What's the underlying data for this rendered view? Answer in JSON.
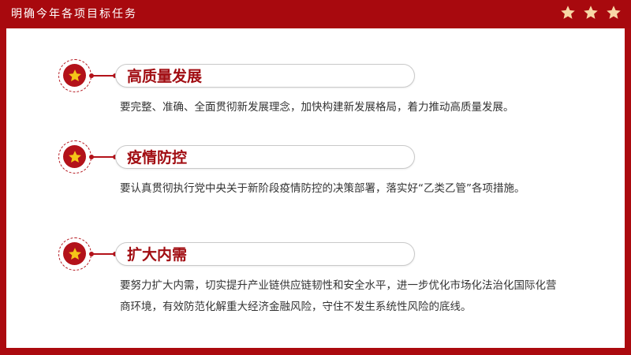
{
  "header": {
    "title": "明确今年各项目标任务",
    "star_count": 3,
    "star_color": "#f8d7a6"
  },
  "colors": {
    "brand_red": "#ab0a0f",
    "accent_red": "#b3121a",
    "star_gold": "#f5c518",
    "text_dark": "#333333"
  },
  "sections": [
    {
      "title": "高质量发展",
      "description": "要完整、准确、全面贯彻新发展理念，加快构建新发展格局，着力推动高质量发展。"
    },
    {
      "title": "疫情防控",
      "description": "要认真贯彻执行党中央关于新阶段疫情防控的决策部署，落实好“乙类乙管”各项措施。"
    },
    {
      "title": "扩大内需",
      "description": "要努力扩大内需，切实提升产业链供应链韧性和安全水平，进一步优化市场化法治化国际化营商环境，有效防范化解重大经济金融风险，守住不发生系统性风险的底线。"
    }
  ]
}
